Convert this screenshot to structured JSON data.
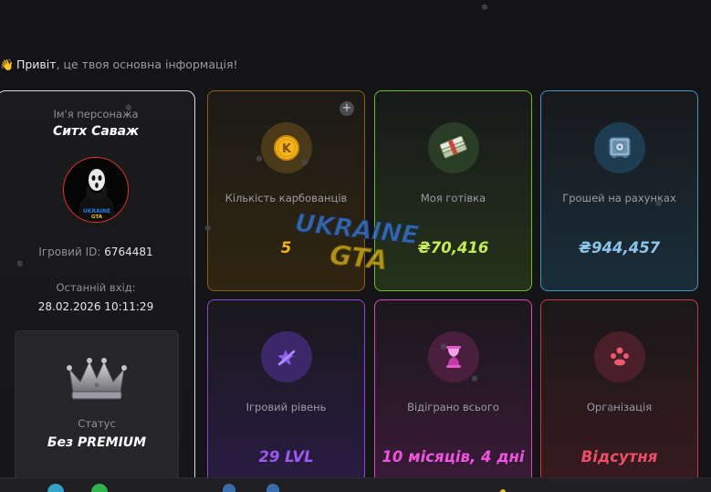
{
  "greeting": {
    "emoji": "👋",
    "hello": "Привіт",
    "rest": ", це твоя основна інформація!"
  },
  "profile": {
    "name_label": "Ім'я персонажа",
    "name": "Ситх Саваж",
    "avatar_caption": "UKRAINE GTA",
    "id_label": "Ігровий ID:",
    "id_value": "6764481",
    "last_login_label": "Останній вхід:",
    "last_login_value": "28.02.2026 10:11:29",
    "status_label": "Статус",
    "status_value": "Без PREMIUM"
  },
  "cards": [
    {
      "label": "Кількість карбованців",
      "value": "5",
      "icon": "coin-k-icon",
      "coin_letter": "K",
      "accent": "#f2b224"
    },
    {
      "label": "Моя готівка",
      "value": "₴70,416",
      "icon": "cash-stack-icon",
      "accent": "#c3ec57"
    },
    {
      "label": "Грошей на рахунках",
      "value": "₴944,457",
      "icon": "safe-icon",
      "accent": "#8cc5ea"
    },
    {
      "label": "Ігровий рівень",
      "value": "29 LVL",
      "icon": "level-star-icon",
      "accent": "#9d58f2"
    },
    {
      "label": "Відіграно всього",
      "value": "10 місяців, 4 дні",
      "icon": "hourglass-icon",
      "accent": "#ef54e0"
    },
    {
      "label": "Організація",
      "value": "Відсутня",
      "icon": "group-icon",
      "accent": "#ef4f66"
    }
  ],
  "add_button": "+",
  "watermark": {
    "line1": "UKRAINE",
    "line2": "GTA"
  }
}
